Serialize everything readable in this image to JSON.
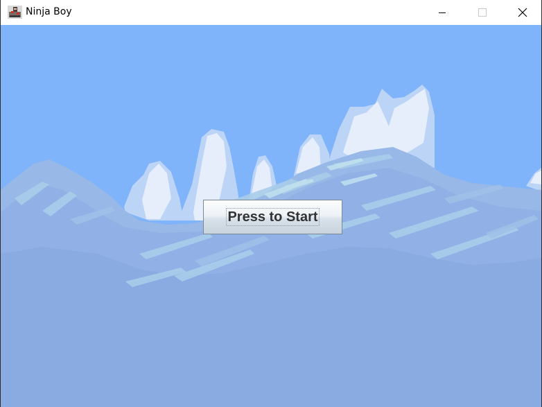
{
  "window": {
    "title": "Ninja Boy",
    "app_icon": "ninja-boy-app-icon",
    "controls": {
      "minimize_icon": "minimize-icon",
      "maximize_icon": "maximize-icon",
      "close_icon": "close-icon"
    }
  },
  "game": {
    "start_button_label": "Press to Start",
    "sky_color": "#7fb3fa",
    "ground_color": "#8aaae2"
  }
}
